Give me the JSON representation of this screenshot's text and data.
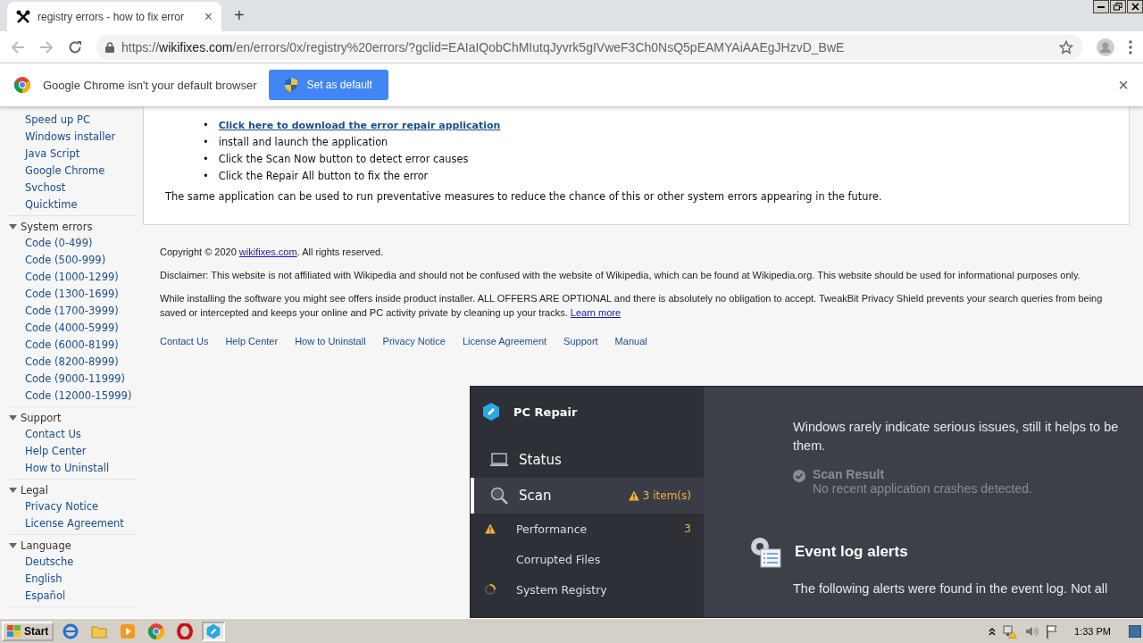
{
  "browser": {
    "tab": {
      "title": "registry errors - how to fix error",
      "close": "×"
    },
    "new_tab": "+",
    "address": {
      "scheme": "https://",
      "host": "wikifixes.com",
      "path": "/en/errors/0x/registry%20errors/?gclid=EAIaIQobChMIutqJyvrk5gIVweF3Ch0NsQ5pEAMYAiAAEgJHzvD_BwE"
    },
    "infobar": {
      "message": "Google Chrome isn't your default browser",
      "button": "Set as default",
      "close": "×"
    }
  },
  "sidebar": [
    {
      "items": [
        "Speed up PC",
        "Windows installer",
        "Java Script",
        "Google Chrome",
        "Svchost",
        "Quicktime"
      ]
    },
    {
      "title": "System errors",
      "expanded": true,
      "items": [
        "Code (0-499)",
        "Code (500-999)",
        "Code (1000-1299)",
        "Code (1300-1699)",
        "Code (1700-3999)",
        "Code (4000-5999)",
        "Code (6000-8199)",
        "Code (8200-8999)",
        "Code (9000-11999)",
        "Code (12000-15999)"
      ]
    },
    {
      "title": "Support",
      "expanded": true,
      "items": [
        "Contact Us",
        "Help Center",
        "How to Uninstall"
      ]
    },
    {
      "title": "Legal",
      "expanded": true,
      "items": [
        "Privacy Notice",
        "License Agreement"
      ]
    },
    {
      "title": "Language",
      "expanded": true,
      "items": [
        "Deutsche",
        "English",
        "Español"
      ]
    }
  ],
  "content": {
    "bullet": "•",
    "steps": [
      {
        "text": "Click here to download the error repair application",
        "kind": "link"
      },
      {
        "text": "install and launch the application",
        "kind": "text"
      },
      {
        "text": "Click the Scan Now button to detect error causes",
        "kind": "text"
      },
      {
        "text": "Click the Repair All button to fix the error",
        "kind": "text"
      }
    ],
    "note": "The same application can be used to run preventative measures to reduce the chance of this or other system errors appearing in the future."
  },
  "footer": {
    "copyright": {
      "before": "Copyright © 2020 ",
      "link": "wikifixes.com",
      "after": ". All rights reserved."
    },
    "disclaimer": "Disclaimer: This website is not affiliated with Wikipedia and should not be confused with the website of Wikipedia, which can be found at Wikipedia.org. This website should be used for informational purposes only.",
    "offers": {
      "text": "While installing the software you might see offers inside product installer. ALL OFFERS ARE OPTIONAL and there is absolutely no obligation to accept. TweakBit Privacy Shield prevents your search queries from being saved or intercepted and keeps your online and PC activity private by cleaning up your tracks.",
      "link": "Learn more"
    },
    "links": [
      "Contact Us",
      "Help Center",
      "How to Uninstall",
      "Privacy Notice",
      "License Agreement",
      "Support",
      "Manual"
    ]
  },
  "pc_repair": {
    "title": "PC Repair",
    "nav": [
      {
        "kind": "main",
        "label": "Status",
        "selected": false
      },
      {
        "kind": "main",
        "label": "Scan",
        "selected": true,
        "badge": "3 item(s)"
      },
      {
        "kind": "sub",
        "label": "Performance",
        "warning": true,
        "loading": false,
        "count": "3"
      },
      {
        "kind": "sub",
        "label": "Corrupted Files",
        "warning": false,
        "loading": false
      },
      {
        "kind": "sub",
        "label": "System Registry",
        "warning": false,
        "loading": true
      }
    ],
    "intro": [
      "Windows rarely indicate serious issues, still it helps to be",
      "them."
    ],
    "result": {
      "title": "Scan Result",
      "text": "No recent application crashes detected."
    },
    "section": {
      "title": "Event log alerts",
      "text": "The following alerts were found in the event log. Not all"
    }
  },
  "taskbar": {
    "start": "Start",
    "clock": "1:33 PM"
  }
}
